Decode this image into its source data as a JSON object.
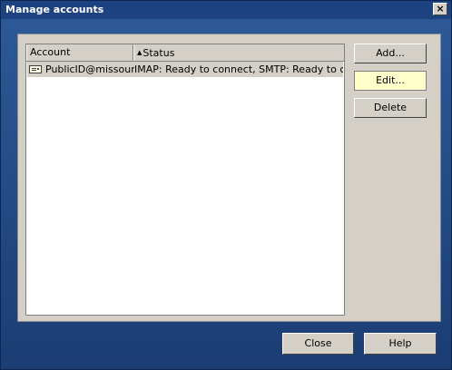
{
  "window": {
    "title": "Manage accounts",
    "close_glyph": "×"
  },
  "list": {
    "columns": [
      {
        "label": "Account"
      },
      {
        "label": "Status",
        "sort_indicator": "▲"
      }
    ],
    "rows": [
      {
        "icon": "account-card-icon",
        "account": "PublicID@missour…",
        "status": "IMAP: Ready to connect, SMTP: Ready to co…"
      }
    ]
  },
  "buttons": {
    "add": "Add...",
    "edit": "Edit...",
    "delete": "Delete",
    "close": "Close",
    "help": "Help"
  },
  "colors": {
    "background": "#2b4f86",
    "panel": "#d4d0c8",
    "highlight_button": "#ffffcc"
  }
}
